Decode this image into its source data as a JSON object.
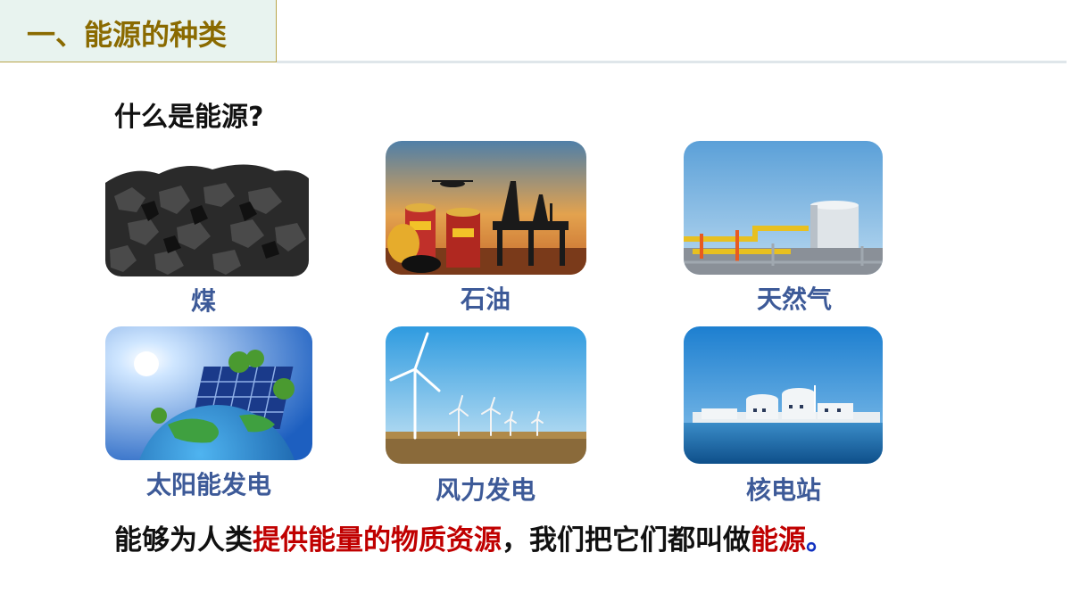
{
  "header": {
    "title": "一、能源的种类"
  },
  "question": "什么是能源?",
  "energy_items": [
    {
      "label": "煤",
      "image": "coal-image"
    },
    {
      "label": "石油",
      "image": "oil-image"
    },
    {
      "label": "天然气",
      "image": "natural-gas-image"
    },
    {
      "label": "太阳能发电",
      "image": "solar-image"
    },
    {
      "label": "风力发电",
      "image": "wind-image"
    },
    {
      "label": "核电站",
      "image": "nuclear-image"
    }
  ],
  "definition": {
    "part1": "能够为人类",
    "part2": "提供能量的物质资源",
    "part3": "，我们把它们都叫做",
    "part4": "能源",
    "part5": "。"
  },
  "colors": {
    "title": "#8a6a00",
    "caption": "#3d5a98",
    "highlight": "#c00000",
    "period": "#1030c0"
  }
}
